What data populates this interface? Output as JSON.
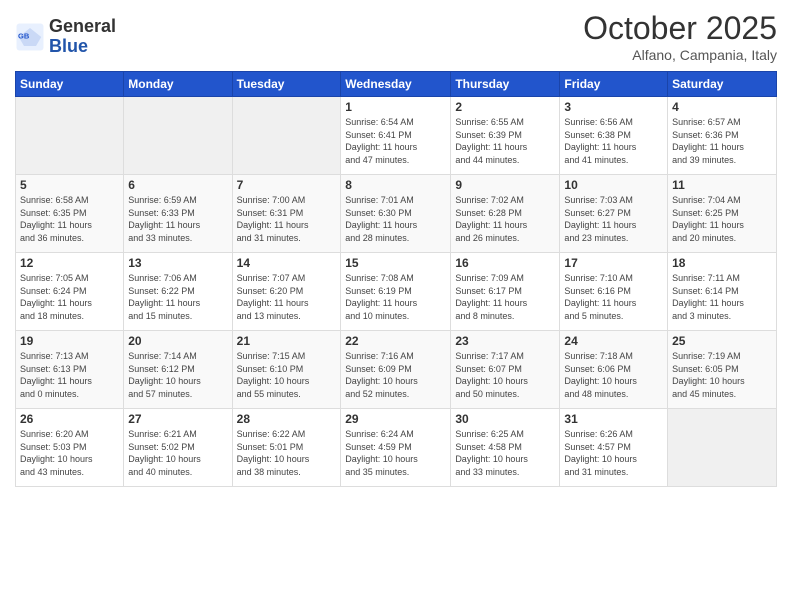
{
  "logo": {
    "general": "General",
    "blue": "Blue"
  },
  "title": "October 2025",
  "subtitle": "Alfano, Campania, Italy",
  "days_header": [
    "Sunday",
    "Monday",
    "Tuesday",
    "Wednesday",
    "Thursday",
    "Friday",
    "Saturday"
  ],
  "weeks": [
    [
      {
        "num": "",
        "info": ""
      },
      {
        "num": "",
        "info": ""
      },
      {
        "num": "",
        "info": ""
      },
      {
        "num": "1",
        "info": "Sunrise: 6:54 AM\nSunset: 6:41 PM\nDaylight: 11 hours\nand 47 minutes."
      },
      {
        "num": "2",
        "info": "Sunrise: 6:55 AM\nSunset: 6:39 PM\nDaylight: 11 hours\nand 44 minutes."
      },
      {
        "num": "3",
        "info": "Sunrise: 6:56 AM\nSunset: 6:38 PM\nDaylight: 11 hours\nand 41 minutes."
      },
      {
        "num": "4",
        "info": "Sunrise: 6:57 AM\nSunset: 6:36 PM\nDaylight: 11 hours\nand 39 minutes."
      }
    ],
    [
      {
        "num": "5",
        "info": "Sunrise: 6:58 AM\nSunset: 6:35 PM\nDaylight: 11 hours\nand 36 minutes."
      },
      {
        "num": "6",
        "info": "Sunrise: 6:59 AM\nSunset: 6:33 PM\nDaylight: 11 hours\nand 33 minutes."
      },
      {
        "num": "7",
        "info": "Sunrise: 7:00 AM\nSunset: 6:31 PM\nDaylight: 11 hours\nand 31 minutes."
      },
      {
        "num": "8",
        "info": "Sunrise: 7:01 AM\nSunset: 6:30 PM\nDaylight: 11 hours\nand 28 minutes."
      },
      {
        "num": "9",
        "info": "Sunrise: 7:02 AM\nSunset: 6:28 PM\nDaylight: 11 hours\nand 26 minutes."
      },
      {
        "num": "10",
        "info": "Sunrise: 7:03 AM\nSunset: 6:27 PM\nDaylight: 11 hours\nand 23 minutes."
      },
      {
        "num": "11",
        "info": "Sunrise: 7:04 AM\nSunset: 6:25 PM\nDaylight: 11 hours\nand 20 minutes."
      }
    ],
    [
      {
        "num": "12",
        "info": "Sunrise: 7:05 AM\nSunset: 6:24 PM\nDaylight: 11 hours\nand 18 minutes."
      },
      {
        "num": "13",
        "info": "Sunrise: 7:06 AM\nSunset: 6:22 PM\nDaylight: 11 hours\nand 15 minutes."
      },
      {
        "num": "14",
        "info": "Sunrise: 7:07 AM\nSunset: 6:20 PM\nDaylight: 11 hours\nand 13 minutes."
      },
      {
        "num": "15",
        "info": "Sunrise: 7:08 AM\nSunset: 6:19 PM\nDaylight: 11 hours\nand 10 minutes."
      },
      {
        "num": "16",
        "info": "Sunrise: 7:09 AM\nSunset: 6:17 PM\nDaylight: 11 hours\nand 8 minutes."
      },
      {
        "num": "17",
        "info": "Sunrise: 7:10 AM\nSunset: 6:16 PM\nDaylight: 11 hours\nand 5 minutes."
      },
      {
        "num": "18",
        "info": "Sunrise: 7:11 AM\nSunset: 6:14 PM\nDaylight: 11 hours\nand 3 minutes."
      }
    ],
    [
      {
        "num": "19",
        "info": "Sunrise: 7:13 AM\nSunset: 6:13 PM\nDaylight: 11 hours\nand 0 minutes."
      },
      {
        "num": "20",
        "info": "Sunrise: 7:14 AM\nSunset: 6:12 PM\nDaylight: 10 hours\nand 57 minutes."
      },
      {
        "num": "21",
        "info": "Sunrise: 7:15 AM\nSunset: 6:10 PM\nDaylight: 10 hours\nand 55 minutes."
      },
      {
        "num": "22",
        "info": "Sunrise: 7:16 AM\nSunset: 6:09 PM\nDaylight: 10 hours\nand 52 minutes."
      },
      {
        "num": "23",
        "info": "Sunrise: 7:17 AM\nSunset: 6:07 PM\nDaylight: 10 hours\nand 50 minutes."
      },
      {
        "num": "24",
        "info": "Sunrise: 7:18 AM\nSunset: 6:06 PM\nDaylight: 10 hours\nand 48 minutes."
      },
      {
        "num": "25",
        "info": "Sunrise: 7:19 AM\nSunset: 6:05 PM\nDaylight: 10 hours\nand 45 minutes."
      }
    ],
    [
      {
        "num": "26",
        "info": "Sunrise: 6:20 AM\nSunset: 5:03 PM\nDaylight: 10 hours\nand 43 minutes."
      },
      {
        "num": "27",
        "info": "Sunrise: 6:21 AM\nSunset: 5:02 PM\nDaylight: 10 hours\nand 40 minutes."
      },
      {
        "num": "28",
        "info": "Sunrise: 6:22 AM\nSunset: 5:01 PM\nDaylight: 10 hours\nand 38 minutes."
      },
      {
        "num": "29",
        "info": "Sunrise: 6:24 AM\nSunset: 4:59 PM\nDaylight: 10 hours\nand 35 minutes."
      },
      {
        "num": "30",
        "info": "Sunrise: 6:25 AM\nSunset: 4:58 PM\nDaylight: 10 hours\nand 33 minutes."
      },
      {
        "num": "31",
        "info": "Sunrise: 6:26 AM\nSunset: 4:57 PM\nDaylight: 10 hours\nand 31 minutes."
      },
      {
        "num": "",
        "info": ""
      }
    ]
  ]
}
